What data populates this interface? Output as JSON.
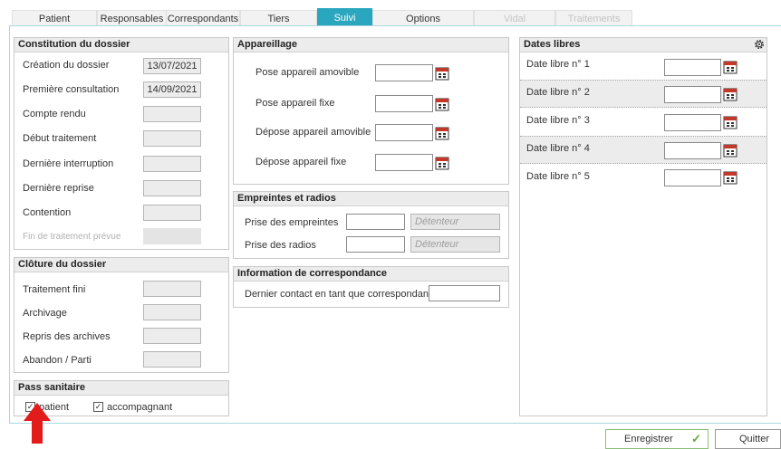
{
  "tabs": [
    {
      "label": "Patient",
      "state": "normal"
    },
    {
      "label": "Responsables",
      "state": "normal"
    },
    {
      "label": "Correspondants",
      "state": "normal"
    },
    {
      "label": "Tiers",
      "state": "normal"
    },
    {
      "label": "Suivi",
      "state": "active"
    },
    {
      "label": "Options",
      "state": "normal"
    },
    {
      "label": "Vidal",
      "state": "disabled"
    },
    {
      "label": "Traitements",
      "state": "disabled"
    }
  ],
  "constitution": {
    "title": "Constitution du dossier",
    "rows": [
      {
        "label": "Création du dossier",
        "value": "13/07/2021"
      },
      {
        "label": "Première consultation",
        "value": "14/09/2021"
      },
      {
        "label": "Compte rendu",
        "value": ""
      },
      {
        "label": "Début traitement",
        "value": ""
      },
      {
        "label": "Dernière interruption",
        "value": ""
      },
      {
        "label": "Dernière reprise",
        "value": ""
      },
      {
        "label": "Contention",
        "value": ""
      },
      {
        "label": "Fin de traitement prévue",
        "value": ""
      }
    ]
  },
  "cloture": {
    "title": "Clôture du dossier",
    "rows": [
      {
        "label": "Traitement fini",
        "value": ""
      },
      {
        "label": "Archivage",
        "value": ""
      },
      {
        "label": "Repris des archives",
        "value": ""
      },
      {
        "label": "Abandon / Parti",
        "value": ""
      }
    ]
  },
  "pass": {
    "title": "Pass sanitaire",
    "items": [
      {
        "label": "patient",
        "checked": true
      },
      {
        "label": "accompagnant",
        "checked": true
      }
    ]
  },
  "appareillage": {
    "title": "Appareillage",
    "rows": [
      {
        "label": "Pose appareil amovible",
        "value": ""
      },
      {
        "label": "Pose appareil fixe",
        "value": ""
      },
      {
        "label": "Dépose appareil amovible",
        "value": ""
      },
      {
        "label": "Dépose appareil fixe",
        "value": ""
      }
    ]
  },
  "empreintes": {
    "title": "Empreintes et radios",
    "rows": [
      {
        "label": "Prise des empreintes",
        "value": "",
        "placeholder": "Détenteur"
      },
      {
        "label": "Prise des radios",
        "value": "",
        "placeholder": "Détenteur"
      }
    ]
  },
  "correspondance": {
    "title": "Information de correspondance",
    "label": "Dernier contact en tant que correspondant",
    "value": ""
  },
  "dates_libres": {
    "title": "Dates libres",
    "rows": [
      {
        "label": "Date libre n° 1",
        "value": ""
      },
      {
        "label": "Date libre n° 2",
        "value": ""
      },
      {
        "label": "Date libre n° 3",
        "value": ""
      },
      {
        "label": "Date libre n° 4",
        "value": ""
      },
      {
        "label": "Date libre n° 5",
        "value": ""
      }
    ]
  },
  "footer": {
    "save_label": "Enregistrer",
    "quit_label": "Quitter"
  },
  "colors": {
    "accent": "#2aa6bf",
    "arrow": "#e21b1b",
    "save_check": "#63a83a"
  },
  "icons": [
    "calendar-icon",
    "gear-icon",
    "check-icon",
    "red-up-arrow"
  ]
}
